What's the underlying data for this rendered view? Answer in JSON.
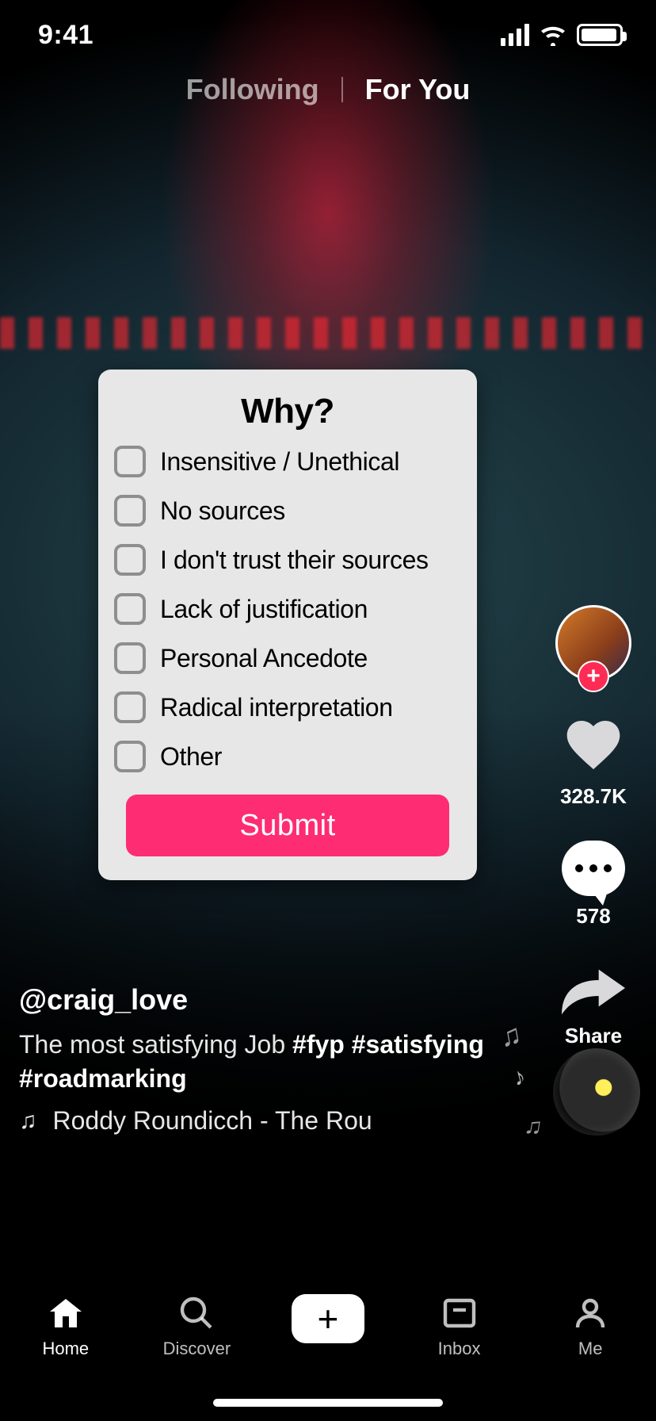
{
  "status_bar": {
    "time": "9:41"
  },
  "feed_tabs": {
    "following": "Following",
    "for_you": "For You"
  },
  "right_rail": {
    "likes": "328.7K",
    "comments": "578",
    "share": "Share"
  },
  "caption": {
    "username": "@craig_love",
    "text_prefix": "The most satisfying Job ",
    "hashtags": "#fyp #satisfying #roadmarking"
  },
  "sound": {
    "label": "Roddy Roundicch - The Rou"
  },
  "tabbar": {
    "home": "Home",
    "discover": "Discover",
    "inbox": "Inbox",
    "me": "Me"
  },
  "modal": {
    "title": "Why?",
    "options": [
      "Insensitive / Unethical",
      "No sources",
      "I don't trust their sources",
      "Lack of justification",
      "Personal Ancedote",
      "Radical interpretation",
      "Other"
    ],
    "submit": "Submit"
  }
}
